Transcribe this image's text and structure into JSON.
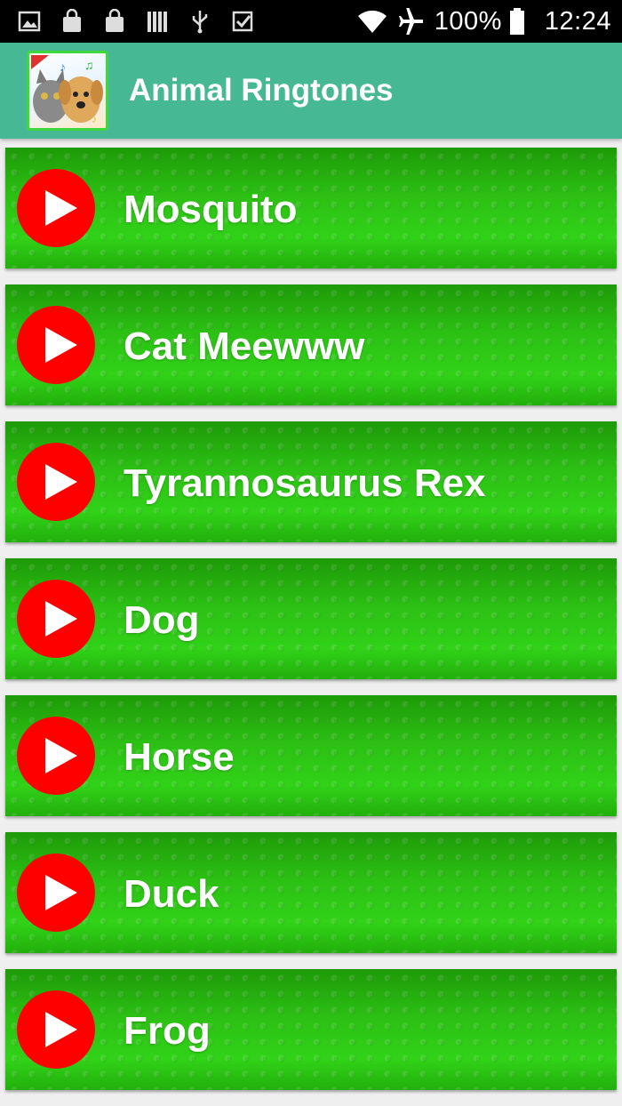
{
  "status_bar": {
    "battery": "100%",
    "time": "12:24",
    "left_icons": [
      "gallery-icon",
      "shopping-bag-icon",
      "shopping-bag-icon",
      "library-icon",
      "usb-icon",
      "checkmark-icon"
    ],
    "right_icons": [
      "wifi-icon",
      "airplane-mode-icon",
      "battery-icon"
    ]
  },
  "app_bar": {
    "title": "Animal Ringtones",
    "logo_icon": "app-logo-cat-dog-icon",
    "background": "#47b894"
  },
  "ringtones": [
    {
      "label": "Mosquito",
      "icon": "play-icon"
    },
    {
      "label": "Cat Meewww",
      "icon": "play-icon"
    },
    {
      "label": "Tyrannosaurus Rex",
      "icon": "play-icon"
    },
    {
      "label": "Dog",
      "icon": "play-icon"
    },
    {
      "label": "Horse",
      "icon": "play-icon"
    },
    {
      "label": "Duck",
      "icon": "play-icon"
    },
    {
      "label": "Frog",
      "icon": "play-icon"
    }
  ],
  "colors": {
    "play_button": "#ff0000",
    "item_green": "#2cc014",
    "status_bar": "#000000"
  }
}
